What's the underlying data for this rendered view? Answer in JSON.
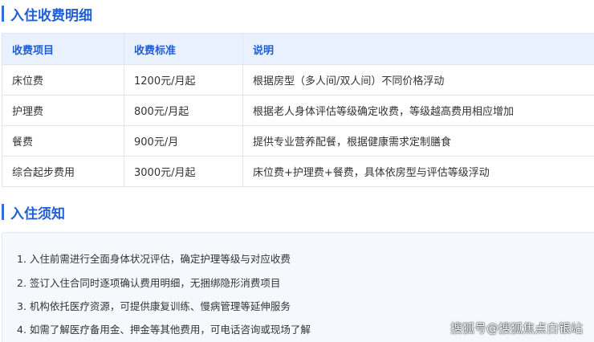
{
  "sections": {
    "fees_title": "入住收费明细",
    "notes_title": "入住须知"
  },
  "table": {
    "headers": [
      "收费项目",
      "收费标准",
      "说明"
    ],
    "rows": [
      [
        "床位费",
        "1200元/月起",
        "根据房型（多人间/双人间）不同价格浮动"
      ],
      [
        "护理费",
        "800元/月起",
        "根据老人身体评估等级确定收费，等级越高费用相应增加"
      ],
      [
        "餐费",
        "900元/月",
        "提供专业营养配餐，根据健康需求定制膳食"
      ],
      [
        "综合起步费用",
        "3000元/月起",
        "床位费+护理费+餐费，具体依房型与评估等级浮动"
      ]
    ]
  },
  "notes": [
    "1. 入住前需进行全面身体状况评估，确定护理等级与对应收费",
    "2. 签订入住合同时逐项确认费用明细，无捆绑隐形消费项目",
    "3. 机构依托医疗资源，可提供康复训练、慢病管理等延伸服务",
    "4. 如需了解医疗备用金、押金等其他费用，可电话咨询或现场了解"
  ],
  "watermark": "搜狐号@搜狐焦点白银站",
  "colors": {
    "accent": "#1f5fd6",
    "header_bg": "#e9f1fe",
    "border": "#dfe6f2",
    "notes_bg": "#f5f8fc"
  }
}
